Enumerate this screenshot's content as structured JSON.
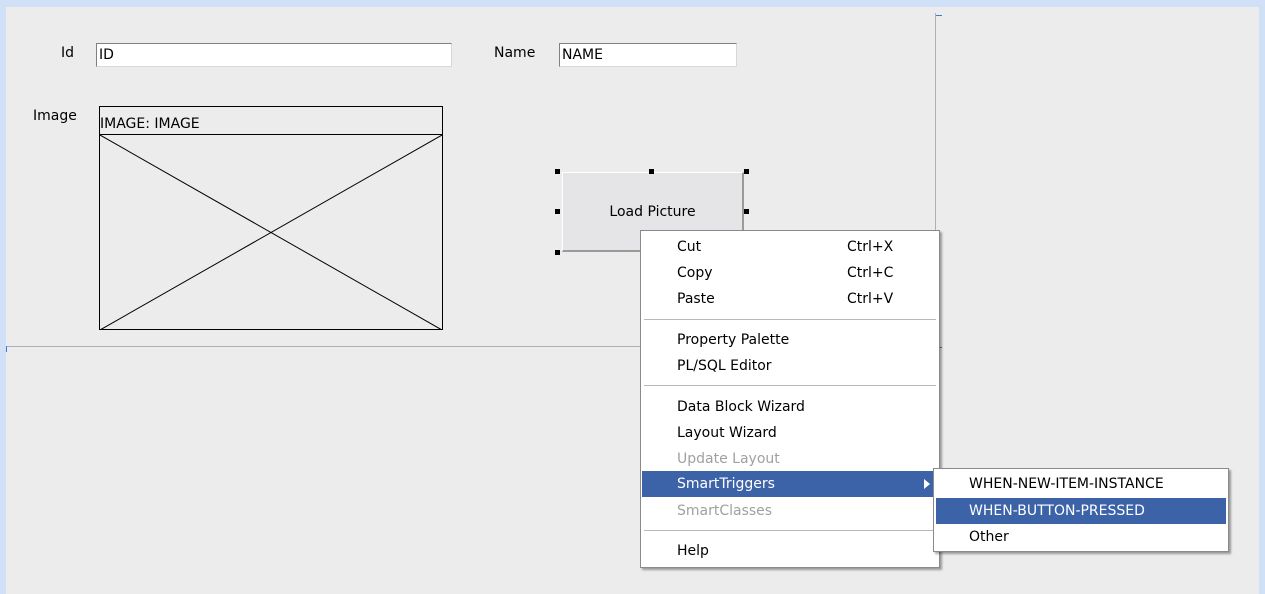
{
  "form": {
    "id_label": "Id",
    "id_value": "ID",
    "name_label": "Name",
    "name_value": "NAME",
    "image_label": "Image",
    "image_caption": "IMAGE: IMAGE",
    "button_label": "Load Picture"
  },
  "context_menu": {
    "items": [
      {
        "label": "Cut",
        "shortcut": "Ctrl+X",
        "enabled": true
      },
      {
        "label": "Copy",
        "shortcut": "Ctrl+C",
        "enabled": true
      },
      {
        "label": "Paste",
        "shortcut": "Ctrl+V",
        "enabled": true
      },
      {
        "label": "Property Palette",
        "enabled": true
      },
      {
        "label": "PL/SQL Editor",
        "enabled": true
      },
      {
        "label": "Data Block Wizard",
        "enabled": true
      },
      {
        "label": "Layout Wizard",
        "enabled": true
      },
      {
        "label": "Update Layout",
        "enabled": false
      },
      {
        "label": "SmartTriggers",
        "enabled": true,
        "selected": true,
        "has_submenu": true
      },
      {
        "label": "SmartClasses",
        "enabled": false
      },
      {
        "label": "Help",
        "enabled": true
      }
    ]
  },
  "submenu": {
    "items": [
      {
        "label": "WHEN-NEW-ITEM-INSTANCE",
        "selected": false
      },
      {
        "label": "WHEN-BUTTON-PRESSED",
        "selected": true
      },
      {
        "label": "Other",
        "selected": false
      }
    ]
  },
  "colors": {
    "selection": "#3c62a8",
    "canvas_background": "#ececec",
    "frame": "#cfe0f7"
  }
}
